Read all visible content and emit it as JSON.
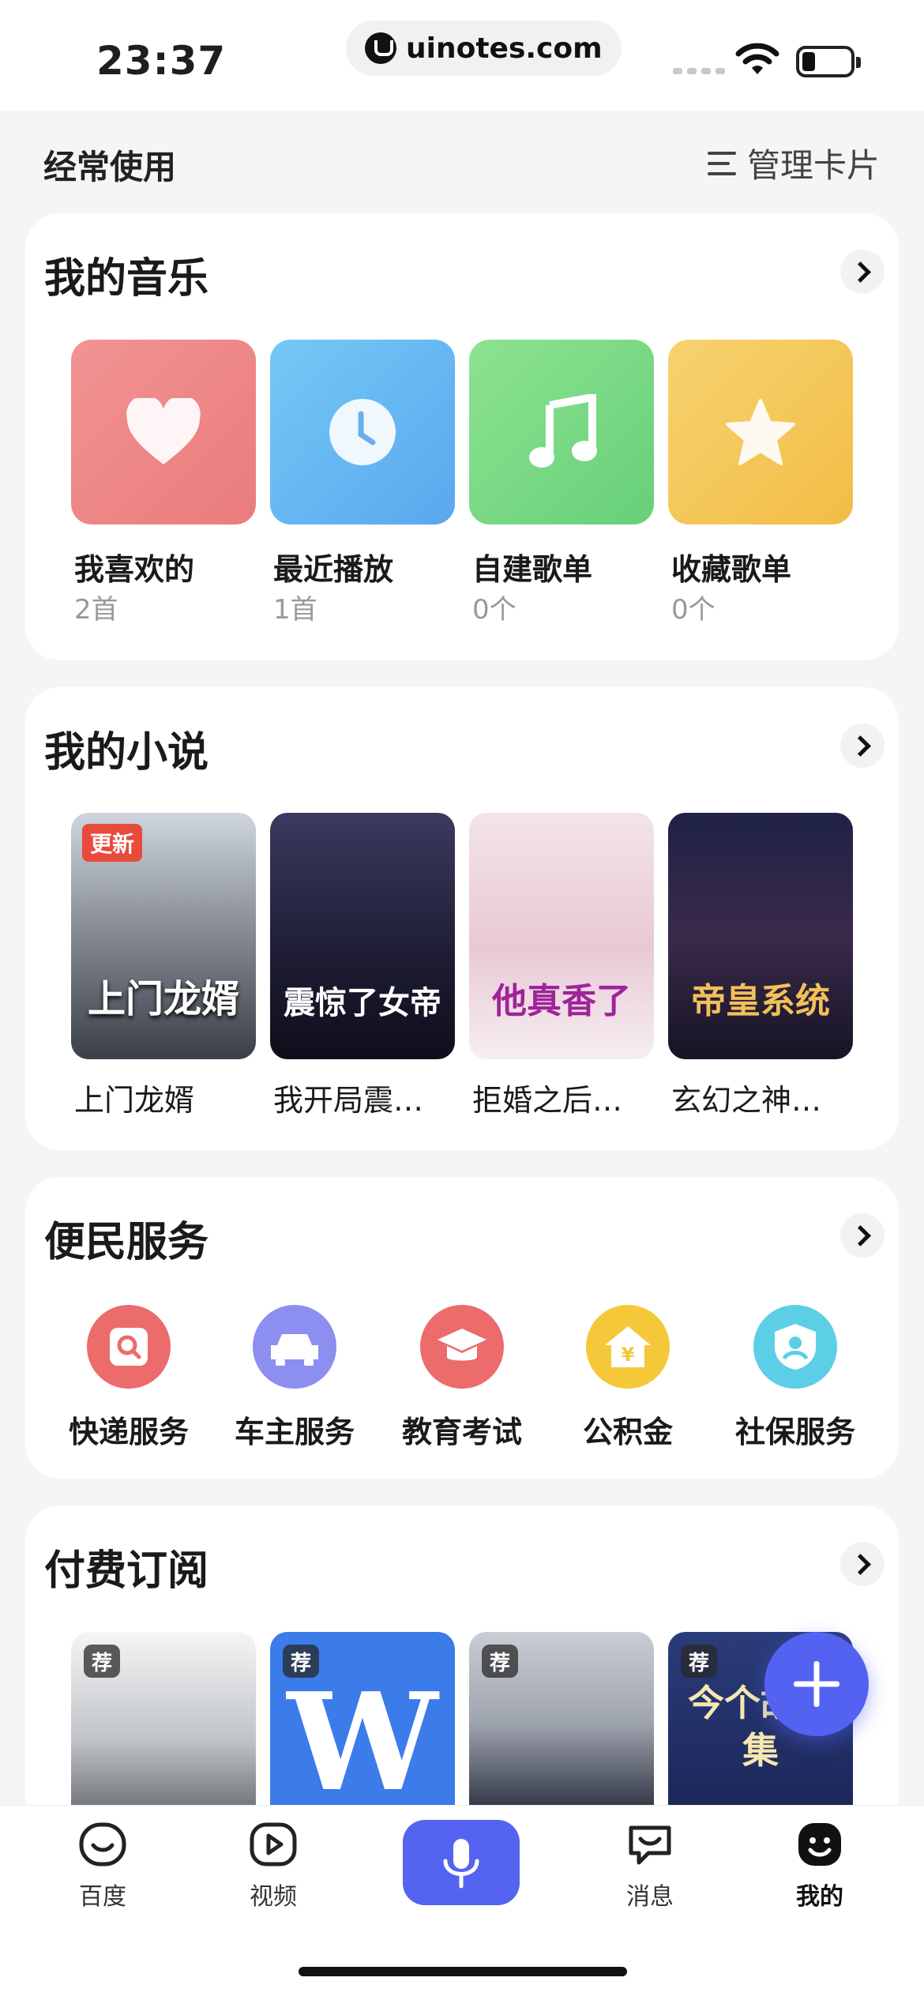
{
  "status_bar": {
    "time": "23:37",
    "url": "uinotes.com"
  },
  "section": {
    "title": "经常使用",
    "manage_label": "管理卡片"
  },
  "music": {
    "title": "我的音乐",
    "items": [
      {
        "label": "我喜欢的",
        "count": "2首",
        "icon": "heart-icon",
        "color": "#ee8a8a"
      },
      {
        "label": "最近播放",
        "count": "1首",
        "icon": "clock-icon",
        "color": "#6fb7f3"
      },
      {
        "label": "自建歌单",
        "count": "0个",
        "icon": "music-note-icon",
        "color": "#7fd98a"
      },
      {
        "label": "收藏歌单",
        "count": "0个",
        "icon": "star-icon",
        "color": "#f5c95a"
      }
    ]
  },
  "novels": {
    "title": "我的小说",
    "badge": "更新",
    "items": [
      {
        "label": "上门龙婿",
        "cover_title": "上门龙婿"
      },
      {
        "label": "我开局震…",
        "cover_title": "震惊了女帝"
      },
      {
        "label": "拒婚之后…",
        "cover_title": "他真香了"
      },
      {
        "label": "玄幻之神…",
        "cover_title": "帝皇系统"
      }
    ]
  },
  "services": {
    "title": "便民服务",
    "items": [
      {
        "label": "快递服务",
        "icon": "parcel-search-icon",
        "color": "#ec6b6b"
      },
      {
        "label": "车主服务",
        "icon": "car-icon",
        "color": "#8c8ef0"
      },
      {
        "label": "教育考试",
        "icon": "graduation-cap-icon",
        "color": "#ec6b6b"
      },
      {
        "label": "公积金",
        "icon": "house-yuan-icon",
        "color": "#f5c83a"
      },
      {
        "label": "社保服务",
        "icon": "shield-person-icon",
        "color": "#5ccfe6"
      }
    ]
  },
  "subscriptions": {
    "title": "付费订阅",
    "badge": "荐",
    "items": [
      {
        "name": "subscription-item-1",
        "cover_text": ""
      },
      {
        "name": "subscription-item-2",
        "cover_text": "W"
      },
      {
        "name": "subscription-item-3",
        "cover_text": ""
      },
      {
        "name": "subscription-item-4",
        "cover_text": "今个故事集"
      }
    ]
  },
  "tabs": [
    {
      "label": "百度",
      "icon": "baidu-face-icon"
    },
    {
      "label": "视频",
      "icon": "video-play-icon"
    },
    {
      "label": "消息",
      "icon": "message-icon"
    },
    {
      "label": "我的",
      "icon": "me-face-icon"
    }
  ],
  "colors": {
    "accent": "#5464f0",
    "card": "#ffffff",
    "bg": "#f4f5f7"
  }
}
